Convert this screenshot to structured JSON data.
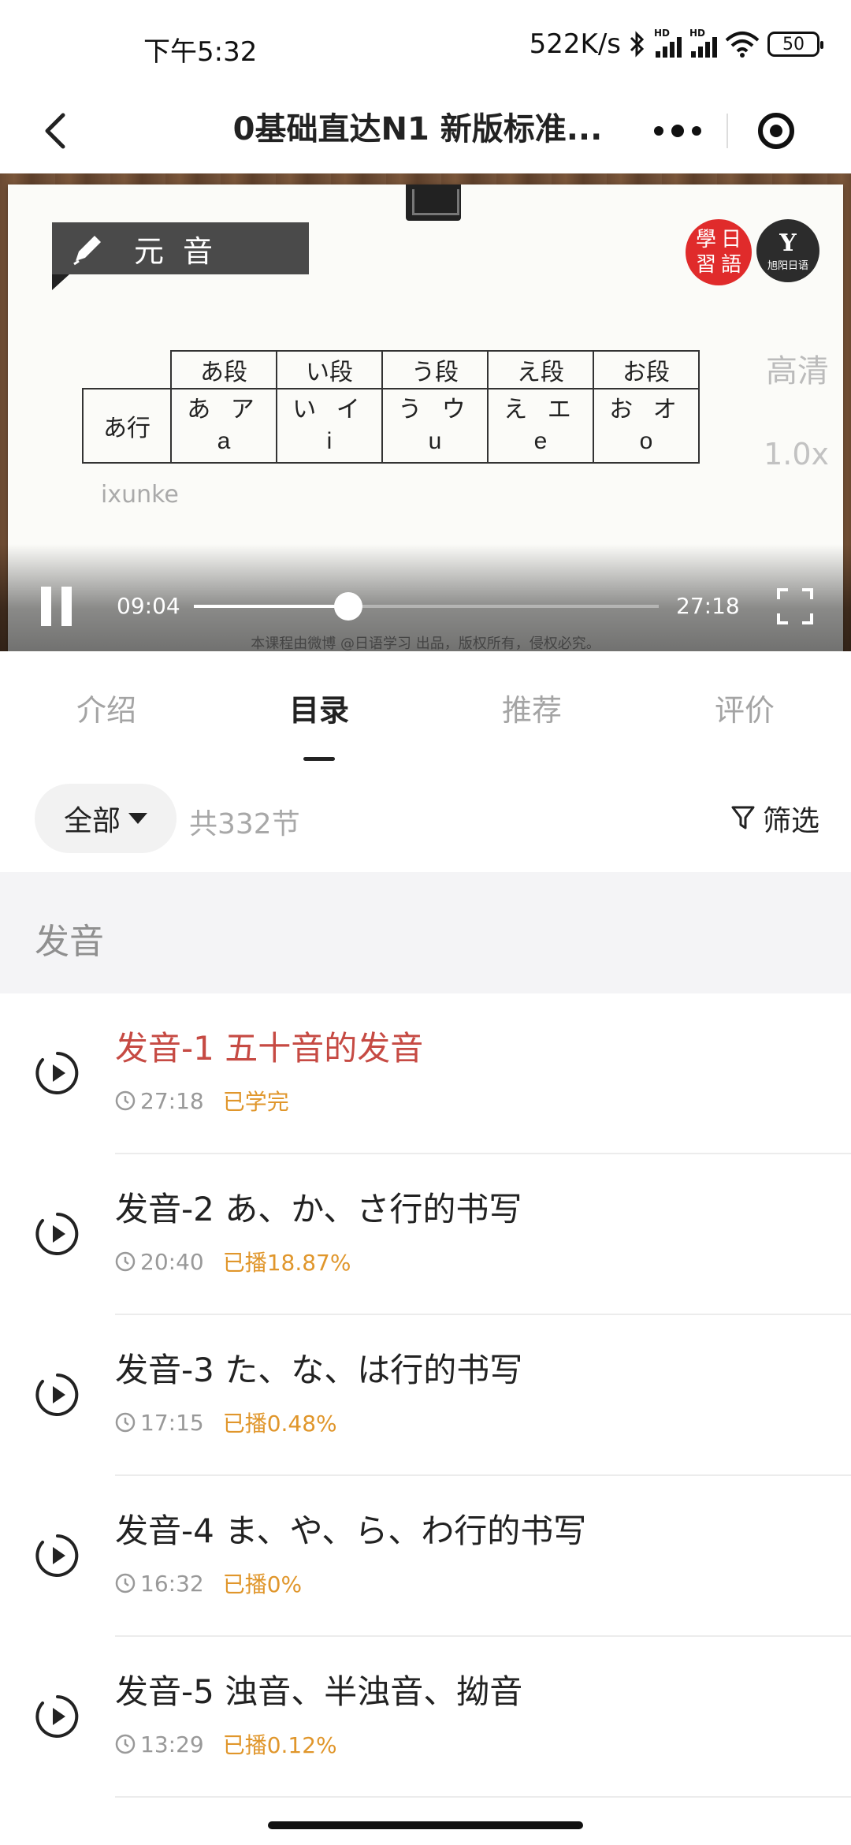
{
  "status_bar": {
    "time": "下午5:32",
    "net_speed": "522K/s",
    "battery": "50"
  },
  "nav": {
    "title": "0基础直达N1 新版标准..."
  },
  "video": {
    "banner_text": "元音",
    "logo_red_chars": [
      "學",
      "日",
      "習",
      "語"
    ],
    "logo_dark_char": "Y",
    "logo_dark_text": "旭阳日语",
    "kana_table": {
      "columns": [
        "あ段",
        "い段",
        "う段",
        "え段",
        "お段"
      ],
      "row_label": "あ行",
      "cells": [
        {
          "kana": "あ ア",
          "romaji": "a"
        },
        {
          "kana": "い イ",
          "romaji": "i"
        },
        {
          "kana": "う ウ",
          "romaji": "u"
        },
        {
          "kana": "え エ",
          "romaji": "e"
        },
        {
          "kana": "お オ",
          "romaji": "o"
        }
      ]
    },
    "watermark": "ixunke",
    "quality": "高清",
    "speed": "1.0x",
    "current_time": "09:04",
    "total_time": "27:18",
    "progress_fraction": 0.332,
    "copyright": "本课程由微博 @日语学习 出品，版权所有，侵权必究。"
  },
  "tabs": [
    {
      "label": "介绍",
      "active": false
    },
    {
      "label": "目录",
      "active": true
    },
    {
      "label": "推荐",
      "active": false
    },
    {
      "label": "评价",
      "active": false
    }
  ],
  "filter": {
    "all_label": "全部",
    "count_text": "共332节",
    "filter_label": "筛选"
  },
  "section": {
    "title": "发音"
  },
  "lessons": [
    {
      "title": "发音-1 五十音的发音",
      "duration": "27:18",
      "progress": "已学完",
      "current": true
    },
    {
      "title": "发音-2 あ、か、さ行的书写",
      "duration": "20:40",
      "progress": "已播18.87%",
      "current": false
    },
    {
      "title": "发音-3 た、な、は行的书写",
      "duration": "17:15",
      "progress": "已播0.48%",
      "current": false
    },
    {
      "title": "发音-4 ま、や、ら、わ行的书写",
      "duration": "16:32",
      "progress": "已播0%",
      "current": false
    },
    {
      "title": "发音-5 浊音、半浊音、拗音",
      "duration": "13:29",
      "progress": "已播0.12%",
      "current": false
    }
  ],
  "colors": {
    "current_lesson": "#c64a43",
    "progress_text": "#e0962b",
    "muted_text": "#a4a4a4"
  }
}
